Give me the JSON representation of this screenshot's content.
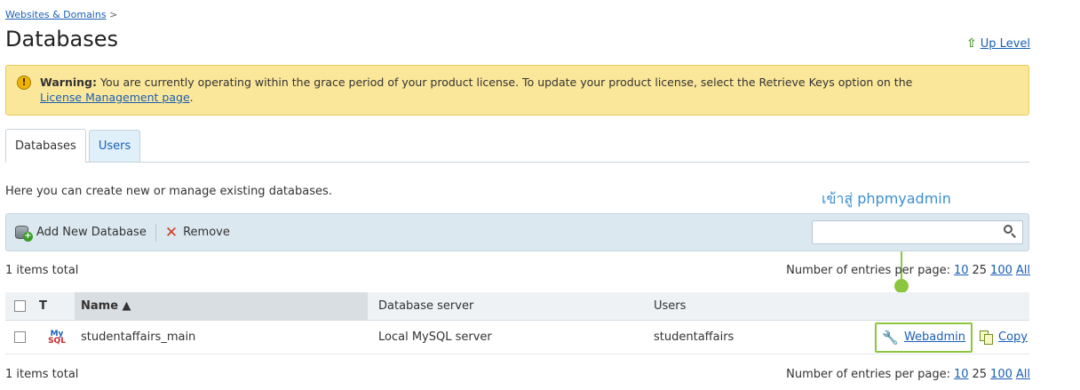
{
  "breadcrumb": {
    "link": "Websites & Domains",
    "sep": ">"
  },
  "page_title": "Databases",
  "up_level": {
    "label": "Up Level",
    "icon": "up-arrow-icon"
  },
  "warning": {
    "label": "Warning:",
    "text": "You are currently operating within the grace period of your product license. To update your product license, select the Retrieve Keys option on the",
    "link": "License Management page",
    "end": "."
  },
  "tabs": [
    {
      "label": "Databases",
      "active": true
    },
    {
      "label": "Users",
      "active": false
    }
  ],
  "intro": "Here you can create new or manage existing databases.",
  "annotation": "เข้าสู่ phpmyadmin",
  "toolbar": {
    "add_label": "Add New Database",
    "remove_label": "Remove",
    "search_value": ""
  },
  "pagination": {
    "total": "1 items total",
    "label": "Number of entries per page:",
    "options": [
      "10",
      "25",
      "100",
      "All"
    ],
    "selected": "10"
  },
  "table": {
    "headers": {
      "type": "T",
      "name": "Name ▲",
      "server": "Database server",
      "users": "Users"
    },
    "rows": [
      {
        "type": "MySQL",
        "name": "studentaffairs_main",
        "server": "Local MySQL server",
        "users": "studentaffairs",
        "actions": {
          "webadmin": "Webadmin",
          "copy": "Copy"
        }
      }
    ]
  },
  "colors": {
    "accent": "#1a5fb4",
    "highlight": "#8cc63f",
    "warning_bg": "#fbe79a"
  }
}
